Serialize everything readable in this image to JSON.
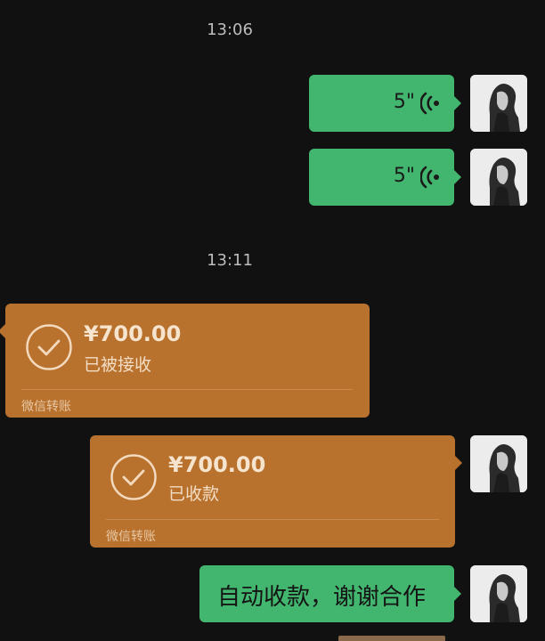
{
  "chat": {
    "time1": "13:06",
    "voice1": {
      "duration": "5\""
    },
    "voice2": {
      "duration": "5\""
    },
    "time2": "13:11",
    "transfer_received": {
      "amount": "¥700.00",
      "status": "已被接收",
      "footer": "微信转账"
    },
    "transfer_sent": {
      "amount": "¥700.00",
      "status": "已收款",
      "footer": "微信转账"
    },
    "text_message": "自动收款，谢谢合作"
  },
  "colors": {
    "background": "#111111",
    "green_bubble": "#42b66e",
    "transfer_bubble": "#b8722e"
  },
  "icons": [
    "voice-wave-icon",
    "check-circle-icon",
    "avatar"
  ]
}
